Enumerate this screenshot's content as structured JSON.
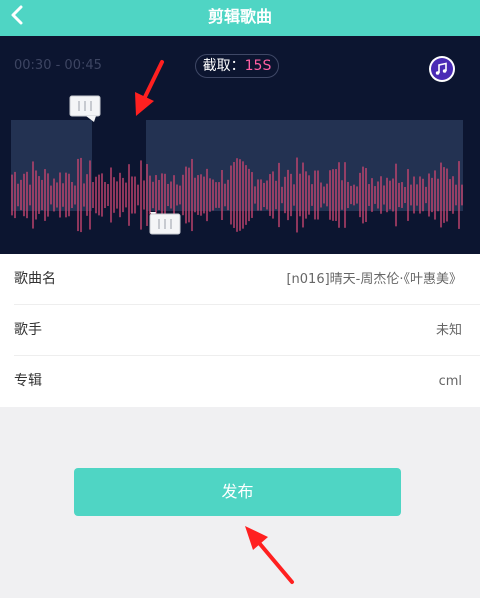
{
  "header": {
    "title": "剪辑歌曲",
    "back_icon": "chevron-left-icon"
  },
  "editor": {
    "time_range": "00:30 - 00:45",
    "clip_label": "截取：",
    "clip_value": "15S",
    "music_icon": "music-note-icon",
    "waveform_color": "#c6456f",
    "selection_start_fraction": 0.18,
    "selection_end_fraction": 0.3
  },
  "song_info": [
    {
      "label": "歌曲名",
      "value": "[n016]晴天-周杰伦·《叶惠美》"
    },
    {
      "label": "歌手",
      "value": "未知"
    },
    {
      "label": "专辑",
      "value": "cml"
    }
  ],
  "actions": {
    "publish_label": "发布"
  },
  "colors": {
    "accent": "#4fd5c4",
    "editor_bg": "#0c1530",
    "highlight": "#ff5fa2",
    "annotation_arrow": "#ff2020"
  }
}
